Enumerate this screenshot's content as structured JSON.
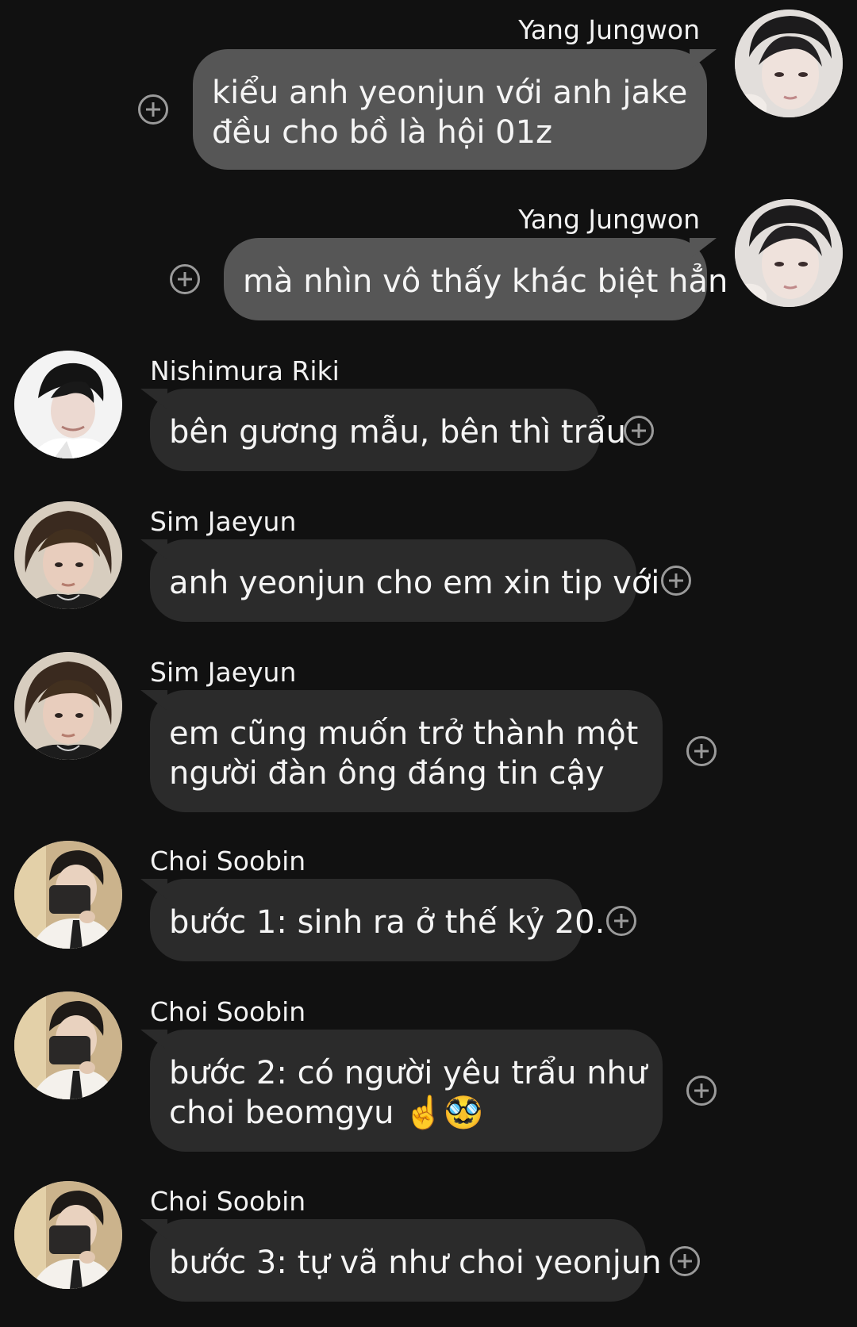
{
  "messages": [
    {
      "sender": "Yang Jungwon",
      "lines": [
        "kiểu anh yeonjun với anh jake",
        "đều cho bồ là hội 01z"
      ]
    },
    {
      "sender": "Yang Jungwon",
      "lines": [
        "mà nhìn vô thấy khác biệt hẳn"
      ]
    },
    {
      "sender": "Nishimura Riki",
      "lines": [
        "bên gương mẫu, bên thì trẩu"
      ]
    },
    {
      "sender": "Sim Jaeyun",
      "lines": [
        "anh yeonjun cho em xin tip với"
      ]
    },
    {
      "sender": "Sim Jaeyun",
      "lines": [
        "em cũng muốn trở thành một",
        "người đàn ông đáng tin cậy"
      ]
    },
    {
      "sender": "Choi Soobin",
      "lines": [
        "bước 1: sinh ra ở thế kỷ 20."
      ]
    },
    {
      "sender": "Choi Soobin",
      "lines": [
        "bước 2: có người yêu trẩu như",
        "choi beomgyu ☝️🥸"
      ]
    },
    {
      "sender": "Choi Soobin",
      "lines": [
        "bước 3: tự vã như choi yeonjun"
      ]
    }
  ],
  "avatars": {
    "yang_jungwon": "avatar-photo",
    "nishimura_riki": "avatar-photo",
    "sim_jaeyun": "avatar-photo",
    "choi_soobin": "avatar-photo"
  },
  "colors": {
    "background": "#111111",
    "incoming_bubble": "#2b2b2b",
    "outgoing_bubble": "#565656",
    "react_icon": "#9a9a9a"
  },
  "icons": {
    "reaction": "add-reaction-icon"
  }
}
